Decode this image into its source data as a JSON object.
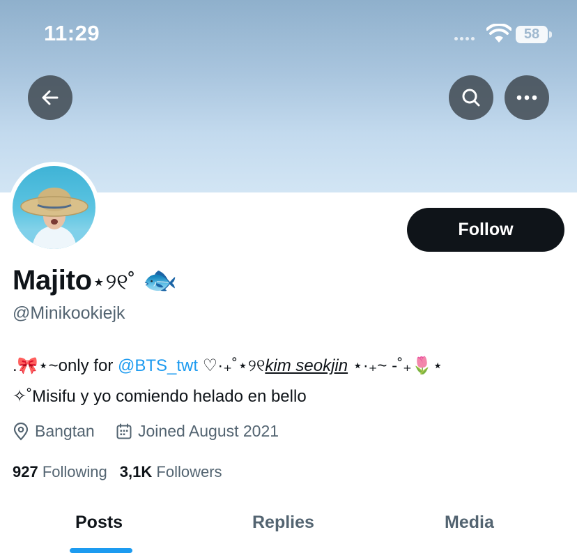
{
  "status_bar": {
    "time": "11:29",
    "battery": "58"
  },
  "header": {
    "back_icon": "arrow-left-icon",
    "search_icon": "search-icon",
    "more_icon": "more-horizontal-icon"
  },
  "profile": {
    "display_name": "Majito",
    "display_name_deco": "⋆୨୧˚",
    "display_name_emoji": "🐟",
    "handle": "@Minikookiejk",
    "follow_label": "Follow",
    "bio_line1": {
      "prefix": ".",
      "bow": "🎀",
      "pre_mention": "⋆~only for ",
      "mention": "@BTS_twt",
      "post_mention": " ♡·₊˚⋆୨୧",
      "underline": "kim seokjin",
      "suffix": " ⋆·₊~ -˚₊",
      "tulip": "🌷",
      "end": "⋆"
    },
    "bio_line2": "✧˚Misifu y yo comiendo helado en bello",
    "location": "Bangtan",
    "joined": "Joined August 2021",
    "following_count": "927",
    "following_label": "Following",
    "followers_count": "3,1K",
    "followers_label": "Followers"
  },
  "tabs": {
    "posts": "Posts",
    "replies": "Replies",
    "media": "Media",
    "active": "Posts"
  },
  "colors": {
    "accent": "#1d9bf0",
    "text_primary": "#0f1419",
    "text_secondary": "#536471",
    "follow_button": "#0f1419"
  }
}
